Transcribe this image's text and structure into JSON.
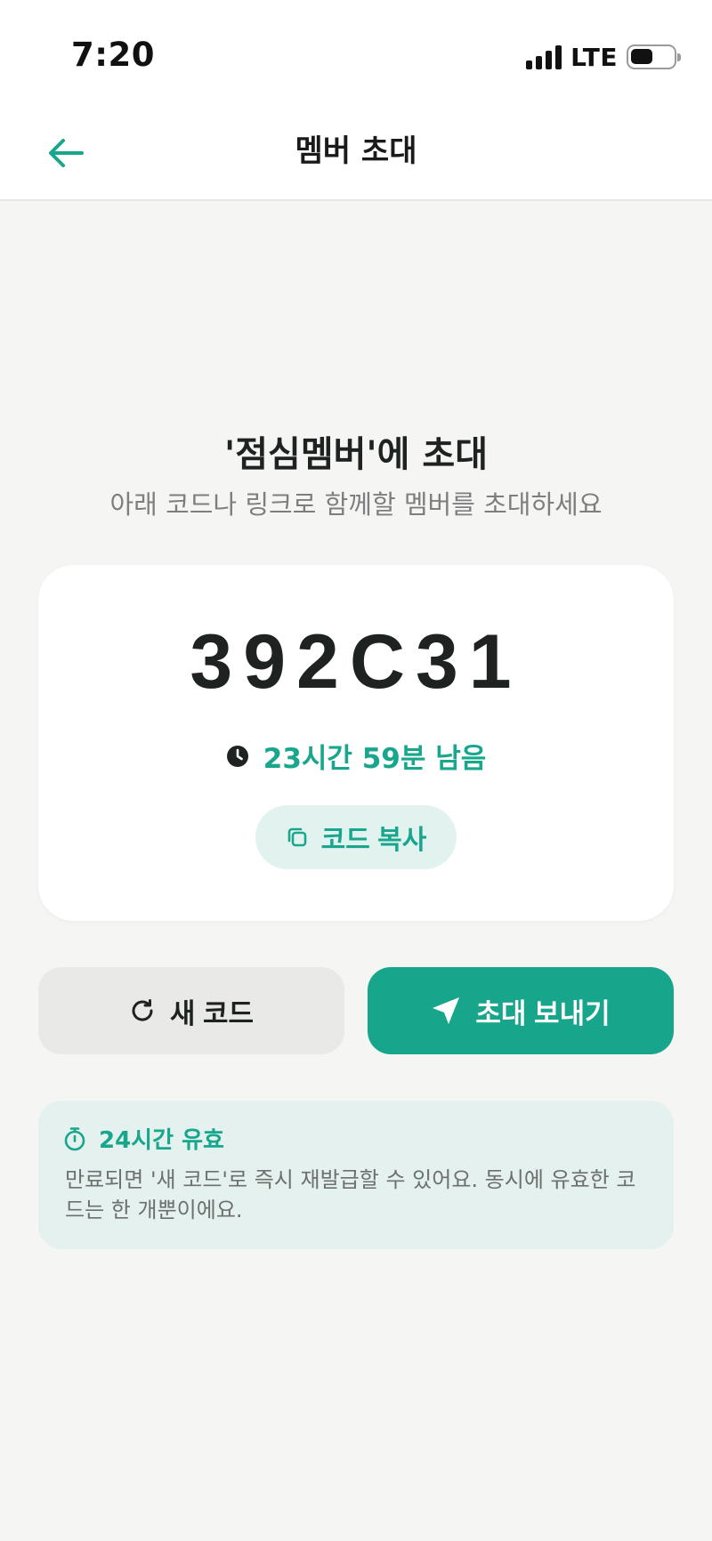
{
  "status_bar": {
    "time": "7:20",
    "network": "LTE",
    "icons": [
      "signal-icon",
      "battery-icon"
    ]
  },
  "nav": {
    "title": "멤버 초대",
    "back_icon": "arrow-left-icon"
  },
  "invite": {
    "headline": "'점심멤버'에 초대",
    "subtext": "아래 코드나 링크로 함께할 멤버를 초대하세요"
  },
  "code_card": {
    "code": "392C31",
    "timer_icon": "clock-icon",
    "time_remaining": "23시간 59분 남음",
    "copy_label": "코드 복사",
    "copy_icon": "copy-icon"
  },
  "actions": {
    "new_code_label": "새 코드",
    "new_code_icon": "refresh-icon",
    "send_label": "초대 보내기",
    "send_icon": "send-icon"
  },
  "info": {
    "icon": "stopwatch-icon",
    "title": "24시간 유효",
    "body": "만료되면 '새 코드'로 즉시 재발급할 수 있어요. 동시에 유효한 코드는 한 개뿐이에요."
  },
  "colors": {
    "accent": "#17a68c",
    "accent_light": "#e2f3ef",
    "info_bg": "#e5f1ee",
    "background": "#f5f5f4"
  }
}
